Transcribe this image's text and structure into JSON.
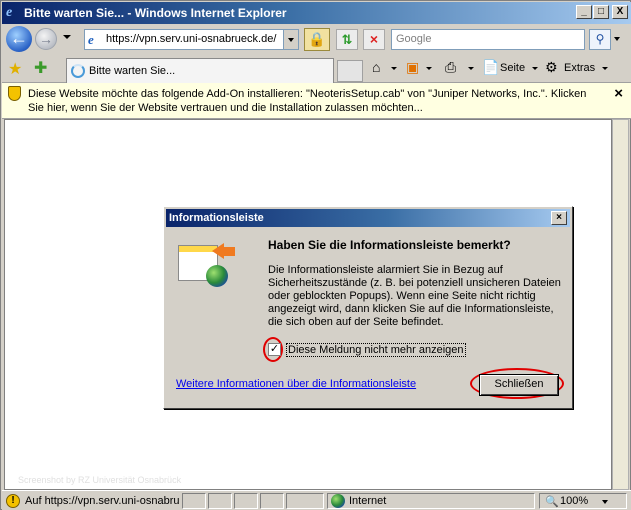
{
  "window": {
    "title": "Bitte warten Sie... - Windows Internet Explorer",
    "minimize": "_",
    "maximize": "□",
    "close": "X"
  },
  "nav": {
    "back_icon": "arrow-left",
    "forward_icon": "arrow-right",
    "url": "https://vpn.serv.uni-osnabrueck.de/",
    "search_placeholder": "Google"
  },
  "tab": {
    "label": "Bitte warten Sie..."
  },
  "commands": {
    "page_label": "Seite",
    "tools_label": "Extras"
  },
  "infobar": {
    "message": "Diese Website möchte das folgende Add-On installieren: \"NeoterisSetup.cab\" von \"Juniper Networks, Inc.\". Klicken Sie hier, wenn Sie der Website vertrauen und die Installation zulassen möchten..."
  },
  "watermark": "Screenshot by RZ Universität Osnabrück",
  "dialog": {
    "title": "Informationsleiste",
    "heading": "Haben Sie die Informationsleiste bemerkt?",
    "body": "Die Informationsleiste alarmiert Sie in Bezug auf Sicherheitszustände (z. B. bei potenziell unsicheren Dateien oder geblockten Popups). Wenn eine Seite nicht richtig angezeigt wird, dann klicken Sie auf die Informationsleiste, die sich oben auf der Seite befindet.",
    "checkbox_label": "Diese Meldung nicht mehr anzeigen",
    "checkbox_checked": true,
    "link": "Weitere Informationen über die Informationsleiste",
    "close_button": "Schließen",
    "highlight_color": "#e00000"
  },
  "status": {
    "text": "Auf https://vpn.serv.uni-osnabrueck.de/ warten...",
    "zone": "Internet",
    "zoom": "100%"
  }
}
